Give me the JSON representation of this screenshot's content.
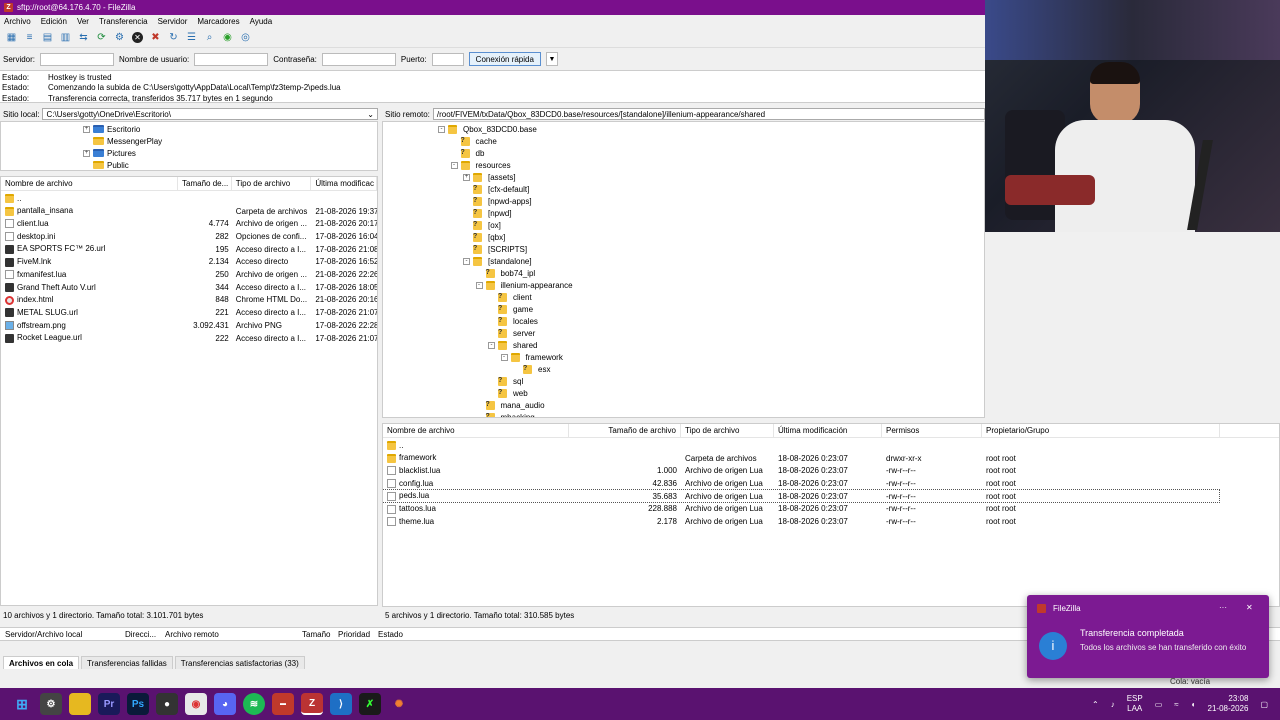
{
  "window": {
    "title": "sftp://root@64.176.4.70 - FileZilla"
  },
  "menu": [
    "Archivo",
    "Edición",
    "Ver",
    "Transferencia",
    "Servidor",
    "Marcadores",
    "Ayuda"
  ],
  "quickconnect": {
    "server_label": "Servidor:",
    "user_label": "Nombre de usuario:",
    "password_label": "Contraseña:",
    "port_label": "Puerto:",
    "connect_button": "Conexión rápida"
  },
  "log": [
    {
      "key": "Estado:",
      "text": "Hostkey is trusted"
    },
    {
      "key": "Estado:",
      "text": "Comenzando la subida de C:\\Users\\gotty\\AppData\\Local\\Temp\\fz3temp-2\\peds.lua"
    },
    {
      "key": "Estado:",
      "text": "Transferencia correcta, transferidos 35.717 bytes en 1 segundo"
    }
  ],
  "local": {
    "site_label": "Sitio local:",
    "path": "C:\\Users\\gotty\\OneDrive\\Escritorio\\",
    "tree": [
      "Escritorio",
      "MessengerPlay",
      "Pictures",
      "Public"
    ],
    "columns": [
      "Nombre de archivo",
      "Tamaño de...",
      "Tipo de archivo",
      "Última modificac"
    ],
    "files": [
      {
        "name": "..",
        "size": "",
        "type": "",
        "date": "",
        "icon": "folder"
      },
      {
        "name": "pantalla_insana",
        "size": "",
        "type": "Carpeta de archivos",
        "date": "21-08-2026 19:37:",
        "icon": "folder"
      },
      {
        "name": "client.lua",
        "size": "4.774",
        "type": "Archivo de origen ...",
        "date": "21-08-2026 20:17:",
        "icon": "file"
      },
      {
        "name": "desktop.ini",
        "size": "282",
        "type": "Opciones de confi...",
        "date": "17-08-2026 16:04:",
        "icon": "file"
      },
      {
        "name": "EA SPORTS FC™ 26.url",
        "size": "195",
        "type": "Acceso directo a I...",
        "date": "17-08-2026 21:08:",
        "icon": "game"
      },
      {
        "name": "FiveM.lnk",
        "size": "2.134",
        "type": "Acceso directo",
        "date": "17-08-2026 16:52:",
        "icon": "game"
      },
      {
        "name": "fxmanifest.lua",
        "size": "250",
        "type": "Archivo de origen ...",
        "date": "21-08-2026 22:26:",
        "icon": "file"
      },
      {
        "name": "Grand Theft Auto V.url",
        "size": "344",
        "type": "Acceso directo a I...",
        "date": "17-08-2026 18:05:",
        "icon": "game"
      },
      {
        "name": "index.html",
        "size": "848",
        "type": "Chrome HTML Do...",
        "date": "21-08-2026 20:16:",
        "icon": "chrome"
      },
      {
        "name": "METAL SLUG.url",
        "size": "221",
        "type": "Acceso directo a I...",
        "date": "17-08-2026 21:07:",
        "icon": "game"
      },
      {
        "name": "offstream.png",
        "size": "3.092.431",
        "type": "Archivo PNG",
        "date": "17-08-2026 22:28:",
        "icon": "image"
      },
      {
        "name": "Rocket League.url",
        "size": "222",
        "type": "Acceso directo a I...",
        "date": "17-08-2026 21:07:",
        "icon": "game"
      }
    ],
    "status": "10 archivos y 1 directorio. Tamaño total: 3.101.701 bytes"
  },
  "remote": {
    "site_label": "Sitio remoto:",
    "path": "/root/FIVEM/txData/Qbox_83DCD0.base/resources/[standalone]/illenium-appearance/shared",
    "tree": [
      {
        "name": "Qbox_83DCD0.base",
        "level": 0,
        "icon": "folder",
        "exp": "-"
      },
      {
        "name": "cache",
        "level": 1,
        "icon": "q",
        "exp": ""
      },
      {
        "name": "db",
        "level": 1,
        "icon": "q",
        "exp": ""
      },
      {
        "name": "resources",
        "level": 1,
        "icon": "folder",
        "exp": "-"
      },
      {
        "name": "[assets]",
        "level": 2,
        "icon": "folder",
        "exp": "+"
      },
      {
        "name": "[cfx-default]",
        "level": 2,
        "icon": "q",
        "exp": ""
      },
      {
        "name": "[npwd-apps]",
        "level": 2,
        "icon": "q",
        "exp": ""
      },
      {
        "name": "[npwd]",
        "level": 2,
        "icon": "q",
        "exp": ""
      },
      {
        "name": "[ox]",
        "level": 2,
        "icon": "q",
        "exp": ""
      },
      {
        "name": "[qbx]",
        "level": 2,
        "icon": "q",
        "exp": ""
      },
      {
        "name": "[SCRIPTS]",
        "level": 2,
        "icon": "q",
        "exp": ""
      },
      {
        "name": "[standalone]",
        "level": 2,
        "icon": "folder",
        "exp": "-"
      },
      {
        "name": "bob74_ipl",
        "level": 3,
        "icon": "q",
        "exp": ""
      },
      {
        "name": "illenium-appearance",
        "level": 3,
        "icon": "folder",
        "exp": "-"
      },
      {
        "name": "client",
        "level": 4,
        "icon": "q",
        "exp": ""
      },
      {
        "name": "game",
        "level": 4,
        "icon": "q",
        "exp": ""
      },
      {
        "name": "locales",
        "level": 4,
        "icon": "q",
        "exp": ""
      },
      {
        "name": "server",
        "level": 4,
        "icon": "q",
        "exp": ""
      },
      {
        "name": "shared",
        "level": 4,
        "icon": "folder",
        "exp": "-"
      },
      {
        "name": "framework",
        "level": 5,
        "icon": "folder",
        "exp": "-"
      },
      {
        "name": "esx",
        "level": 6,
        "icon": "q",
        "exp": ""
      },
      {
        "name": "sql",
        "level": 4,
        "icon": "q",
        "exp": ""
      },
      {
        "name": "web",
        "level": 4,
        "icon": "q",
        "exp": ""
      },
      {
        "name": "mana_audio",
        "level": 3,
        "icon": "q",
        "exp": ""
      },
      {
        "name": "mhacking",
        "level": 3,
        "icon": "q",
        "exp": ""
      }
    ],
    "columns": [
      "Nombre de archivo",
      "Tamaño de archivo",
      "Tipo de archivo",
      "Última modificación",
      "Permisos",
      "Propietario/Grupo"
    ],
    "files": [
      {
        "name": "..",
        "size": "",
        "type": "",
        "date": "",
        "perm": "",
        "owner": "",
        "icon": "folder"
      },
      {
        "name": "framework",
        "size": "",
        "type": "Carpeta de archivos",
        "date": "18-08-2026 0:23:07",
        "perm": "drwxr-xr-x",
        "owner": "root root",
        "icon": "folder"
      },
      {
        "name": "blacklist.lua",
        "size": "1.000",
        "type": "Archivo de origen Lua",
        "date": "18-08-2026 0:23:07",
        "perm": "-rw-r--r--",
        "owner": "root root",
        "icon": "file"
      },
      {
        "name": "config.lua",
        "size": "42.836",
        "type": "Archivo de origen Lua",
        "date": "18-08-2026 0:23:07",
        "perm": "-rw-r--r--",
        "owner": "root root",
        "icon": "file"
      },
      {
        "name": "peds.lua",
        "size": "35.683",
        "type": "Archivo de origen Lua",
        "date": "18-08-2026 0:23:07",
        "perm": "-rw-r--r--",
        "owner": "root root",
        "icon": "file"
      },
      {
        "name": "tattoos.lua",
        "size": "228.888",
        "type": "Archivo de origen Lua",
        "date": "18-08-2026 0:23:07",
        "perm": "-rw-r--r--",
        "owner": "root root",
        "icon": "file"
      },
      {
        "name": "theme.lua",
        "size": "2.178",
        "type": "Archivo de origen Lua",
        "date": "18-08-2026 0:23:07",
        "perm": "-rw-r--r--",
        "owner": "root root",
        "icon": "file"
      }
    ],
    "status": "5 archivos y 1 directorio. Tamaño total: 310.585 bytes"
  },
  "queue": {
    "columns": [
      "Servidor/Archivo local",
      "Direcci...",
      "Archivo remoto",
      "Tamaño",
      "Prioridad",
      "Estado"
    ],
    "tabs": [
      "Archivos en cola",
      "Transferencias fallidas",
      "Transferencias satisfactorias (33)"
    ],
    "footer": "Cola: vacía"
  },
  "toast": {
    "app": "FileZilla",
    "title": "Transferencia completada",
    "body": "Todos los archivos se han transferido con éxito"
  },
  "taskbar": {
    "lang": "ESP",
    "lang2": "LAA",
    "time": "23:08",
    "date": "21-08-2026"
  }
}
